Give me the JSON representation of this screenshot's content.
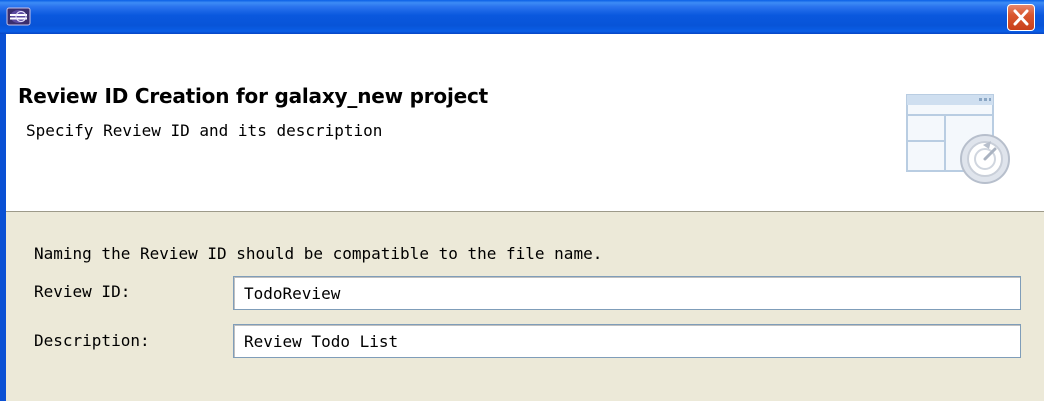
{
  "window": {
    "title": "",
    "close_icon": "close-icon",
    "app_icon": "eclipse-icon",
    "titlebar_color": "#0a58de",
    "close_color": "#d9572f"
  },
  "banner": {
    "title": "Review ID Creation for galaxy_new project",
    "description": "Specify Review ID and its description",
    "image_icon": "wizard-banner-icon"
  },
  "form": {
    "info_text": "Naming the Review ID should be compatible to the file name.",
    "review_id": {
      "label": "Review ID:",
      "value": "TodoReview"
    },
    "description": {
      "label": "Description:",
      "value": "Review Todo List"
    }
  }
}
